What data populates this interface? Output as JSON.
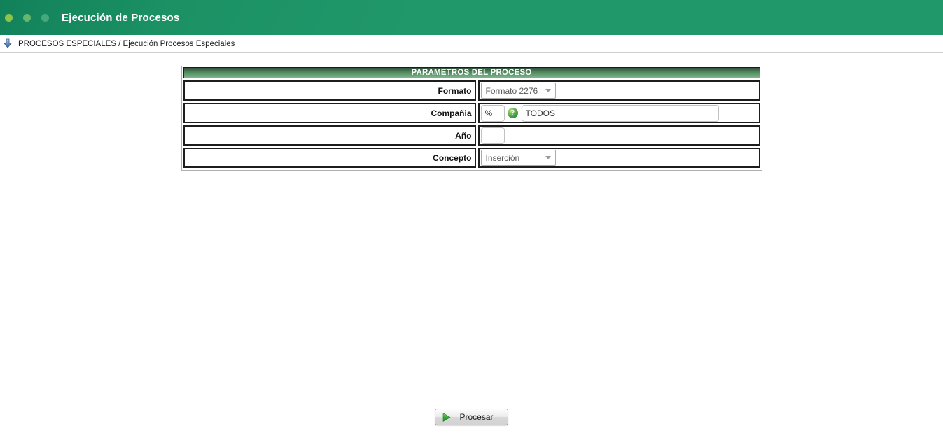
{
  "header": {
    "title": "Ejecución de Procesos"
  },
  "breadcrumb": {
    "text": "PROCESOS ESPECIALES / Ejecución Procesos Especiales"
  },
  "form": {
    "title": "PARAMETROS DEL PROCESO",
    "formato": {
      "label": "Formato",
      "selected": "Formato 2276"
    },
    "compania": {
      "label": "Compañia",
      "wildcard": "%",
      "value": "TODOS",
      "help_glyph": "?"
    },
    "anio": {
      "label": "Año",
      "value": ""
    },
    "concepto": {
      "label": "Concepto",
      "selected": "Inserción"
    }
  },
  "actions": {
    "process_label": "Procesar"
  },
  "colors": {
    "header_green": "#21986a",
    "table_header_green_dark": "#33523d",
    "table_header_green_light": "#7db48b",
    "help_icon_green": "#2f8f3a",
    "play_icon_green": "#2d9b31",
    "dot_bright_green": "#8ec549"
  }
}
